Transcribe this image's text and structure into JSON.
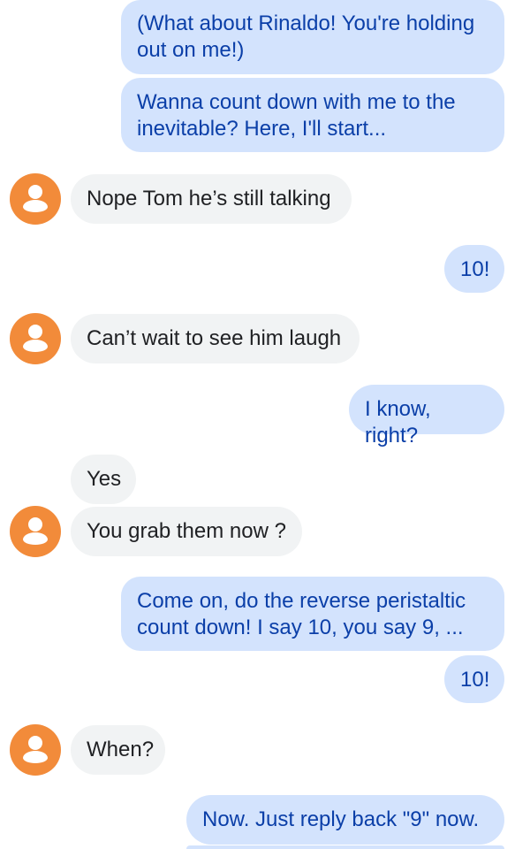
{
  "colors": {
    "outgoing_bubble": "#d3e3fd",
    "outgoing_text": "#0b3fa8",
    "incoming_bubble": "#f1f3f4",
    "incoming_text": "#202124",
    "avatar": "#f28b3a"
  },
  "messages": [
    {
      "direction": "outgoing",
      "text": "(What about Rinaldo!  You're holding\nout on me!)"
    },
    {
      "direction": "outgoing",
      "text": "Wanna count down with me to the\ninevitable?  Here, I'll start..."
    },
    {
      "direction": "incoming",
      "text": "Nope Tom he’s still talking",
      "avatar_icon": "person-icon"
    },
    {
      "direction": "outgoing",
      "text": "10!"
    },
    {
      "direction": "incoming",
      "text": "Can’t wait to see him laugh",
      "avatar_icon": "person-icon"
    },
    {
      "direction": "outgoing",
      "text": "I know, right?"
    },
    {
      "direction": "incoming",
      "text": "Yes"
    },
    {
      "direction": "incoming",
      "text": "You grab them now ?",
      "avatar_icon": "person-icon"
    },
    {
      "direction": "outgoing",
      "text": "Come on, do the reverse peristaltic\ncount down!  I say 10, you say 9, ..."
    },
    {
      "direction": "outgoing",
      "text": "10!"
    },
    {
      "direction": "incoming",
      "text": "When?",
      "avatar_icon": "person-icon"
    },
    {
      "direction": "outgoing",
      "text": "Now.  Just reply back \"9\" now."
    }
  ]
}
